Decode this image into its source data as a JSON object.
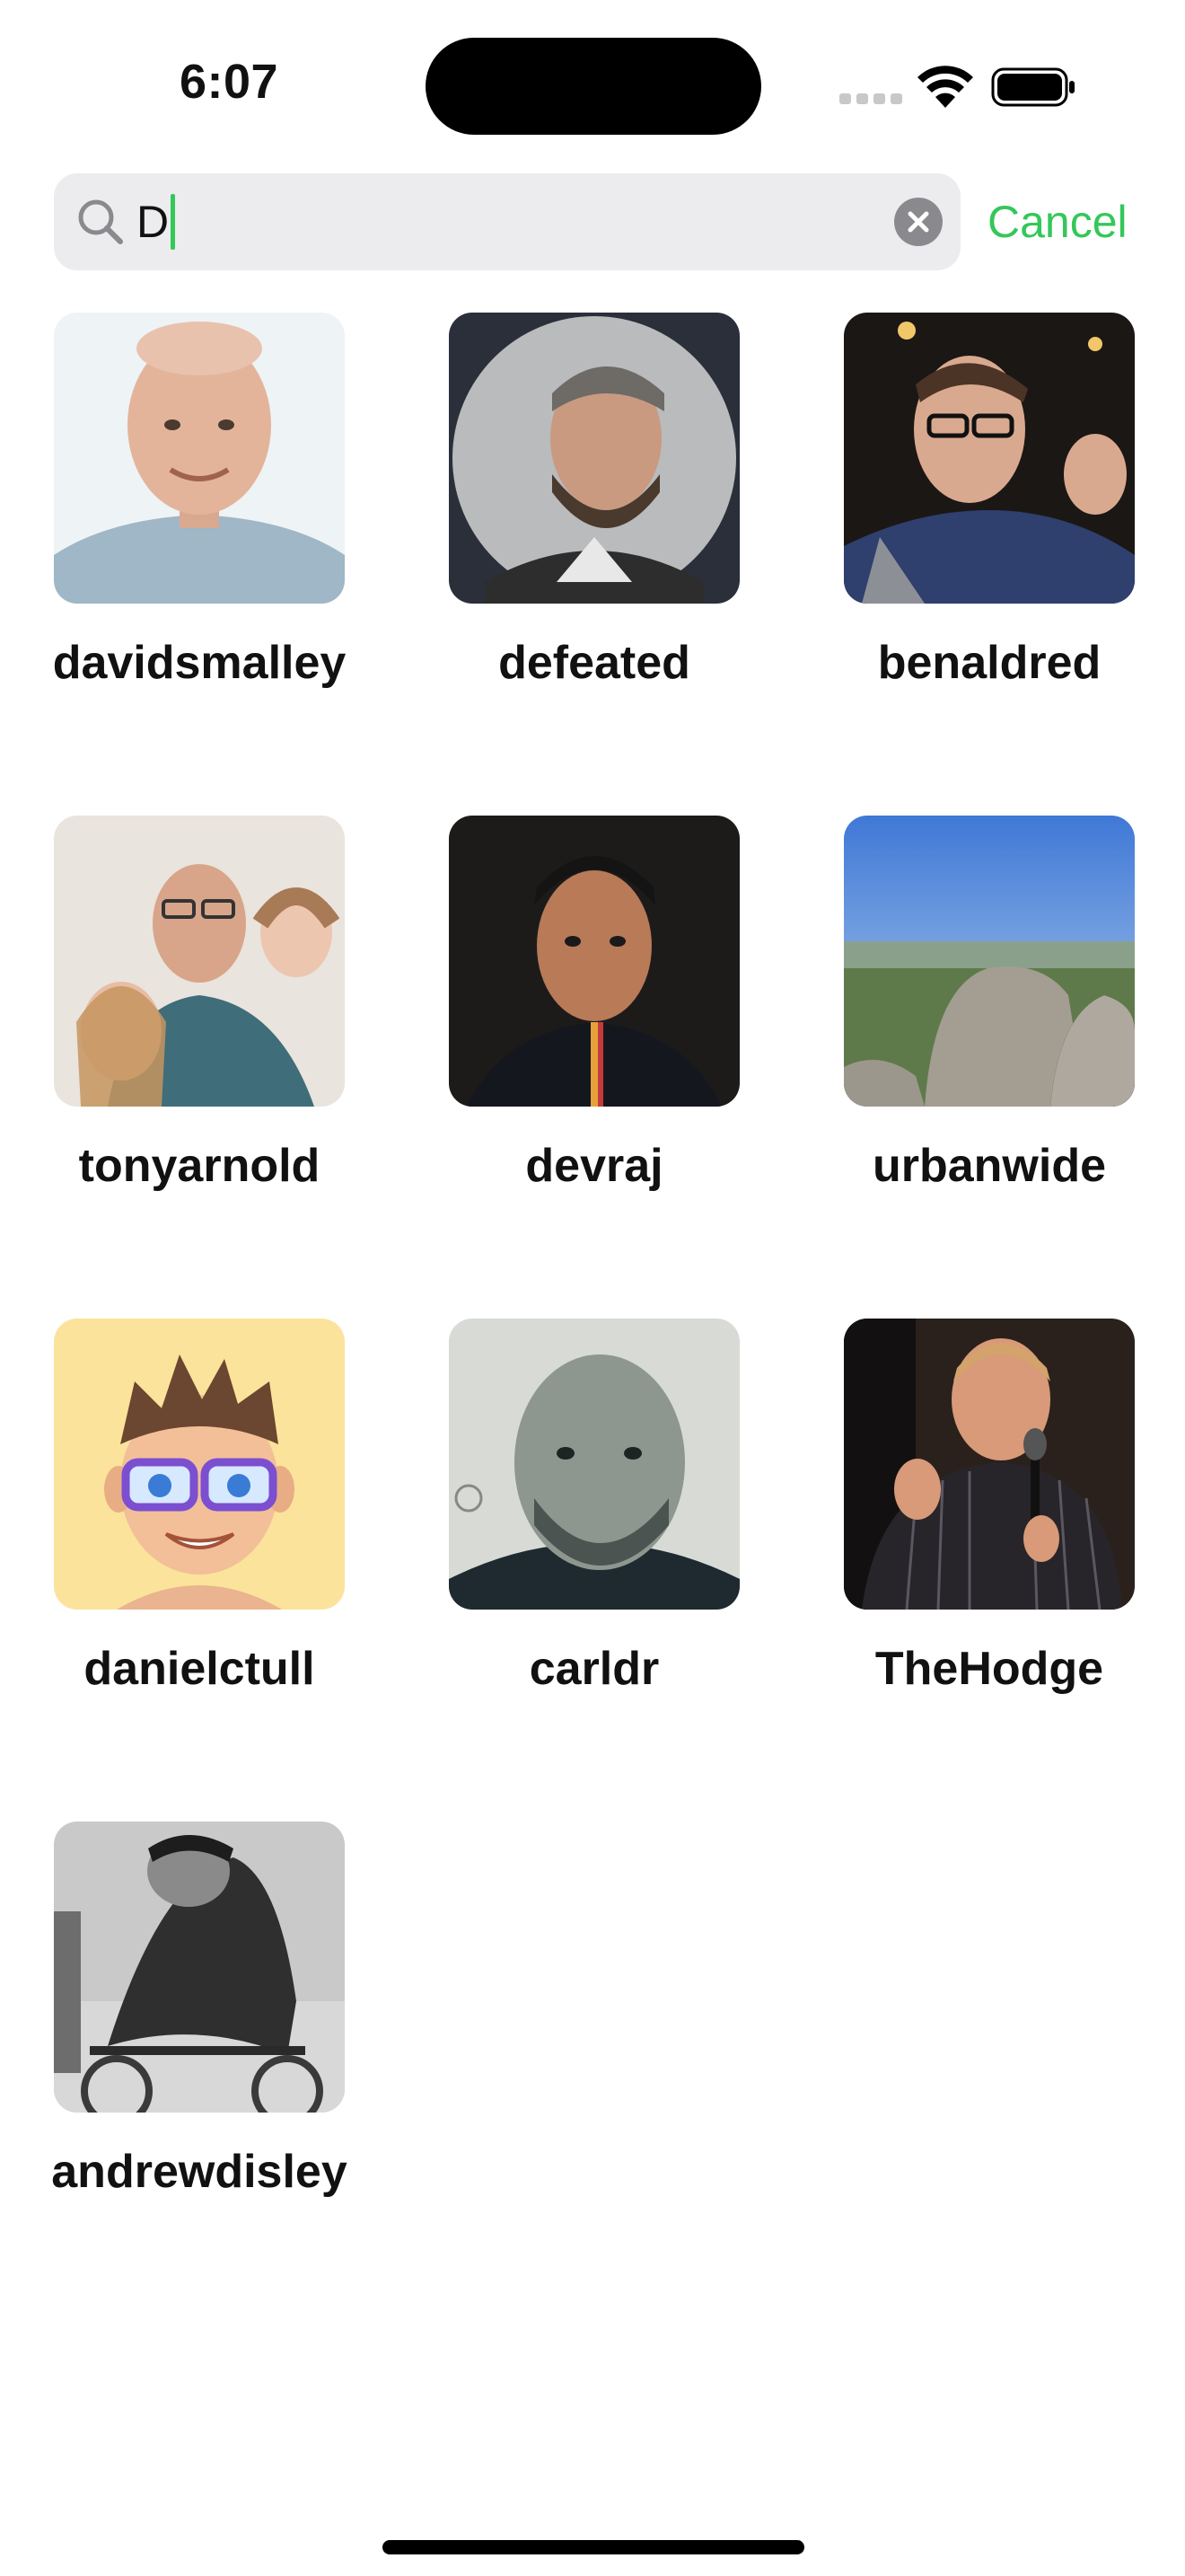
{
  "status_bar": {
    "time": "6:07",
    "signal_icon": "cellular-signal-icon",
    "wifi_icon": "wifi-icon",
    "battery_icon": "battery-icon"
  },
  "search": {
    "query": "D",
    "search_icon": "magnifying-glass-icon",
    "clear_icon": "clear-circle-icon",
    "cancel_label": "Cancel",
    "accent_color": "#34C759"
  },
  "results": [
    {
      "username": "davidsmalley"
    },
    {
      "username": "defeated"
    },
    {
      "username": "benaldred"
    },
    {
      "username": "tonyarnold"
    },
    {
      "username": "devraj"
    },
    {
      "username": "urbanwide"
    },
    {
      "username": "danielctull"
    },
    {
      "username": "carldr"
    },
    {
      "username": "TheHodge"
    },
    {
      "username": "andrewdisley"
    }
  ]
}
